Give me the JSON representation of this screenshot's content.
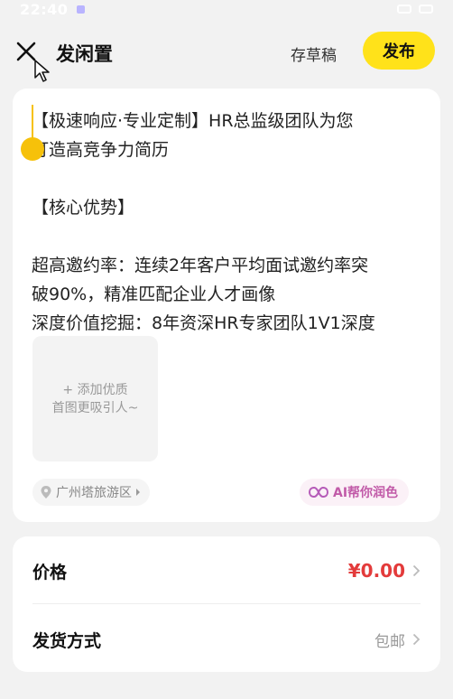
{
  "status_bar": {
    "time": "22:40"
  },
  "header": {
    "title": "发闲置",
    "draft_label": "存草稿",
    "publish_label": "发布"
  },
  "description": {
    "lines": [
      "【极速响应·专业定制】HR总监级团队为您",
      "打造高竞争力简历",
      "",
      "【核心优势】",
      "",
      "超高邀约率：连续2年客户平均面试邀约率突",
      "破90%，精准匹配企业人才画像",
      "深度价值挖掘：8年资深HR专家团队1V1深度"
    ]
  },
  "add_image": {
    "line1": "+ 添加优质",
    "line2": "首图更吸引人~"
  },
  "location": {
    "label": "广州塔旅游区"
  },
  "ai_button": {
    "label": "AI帮你润色"
  },
  "price_row": {
    "label": "价格",
    "value": "¥0.00"
  },
  "shipping_row": {
    "label": "发货方式",
    "value": "包邮"
  },
  "colors": {
    "accent": "#ffe21a",
    "price": "#e33b3b",
    "caret": "#f6c10a"
  }
}
